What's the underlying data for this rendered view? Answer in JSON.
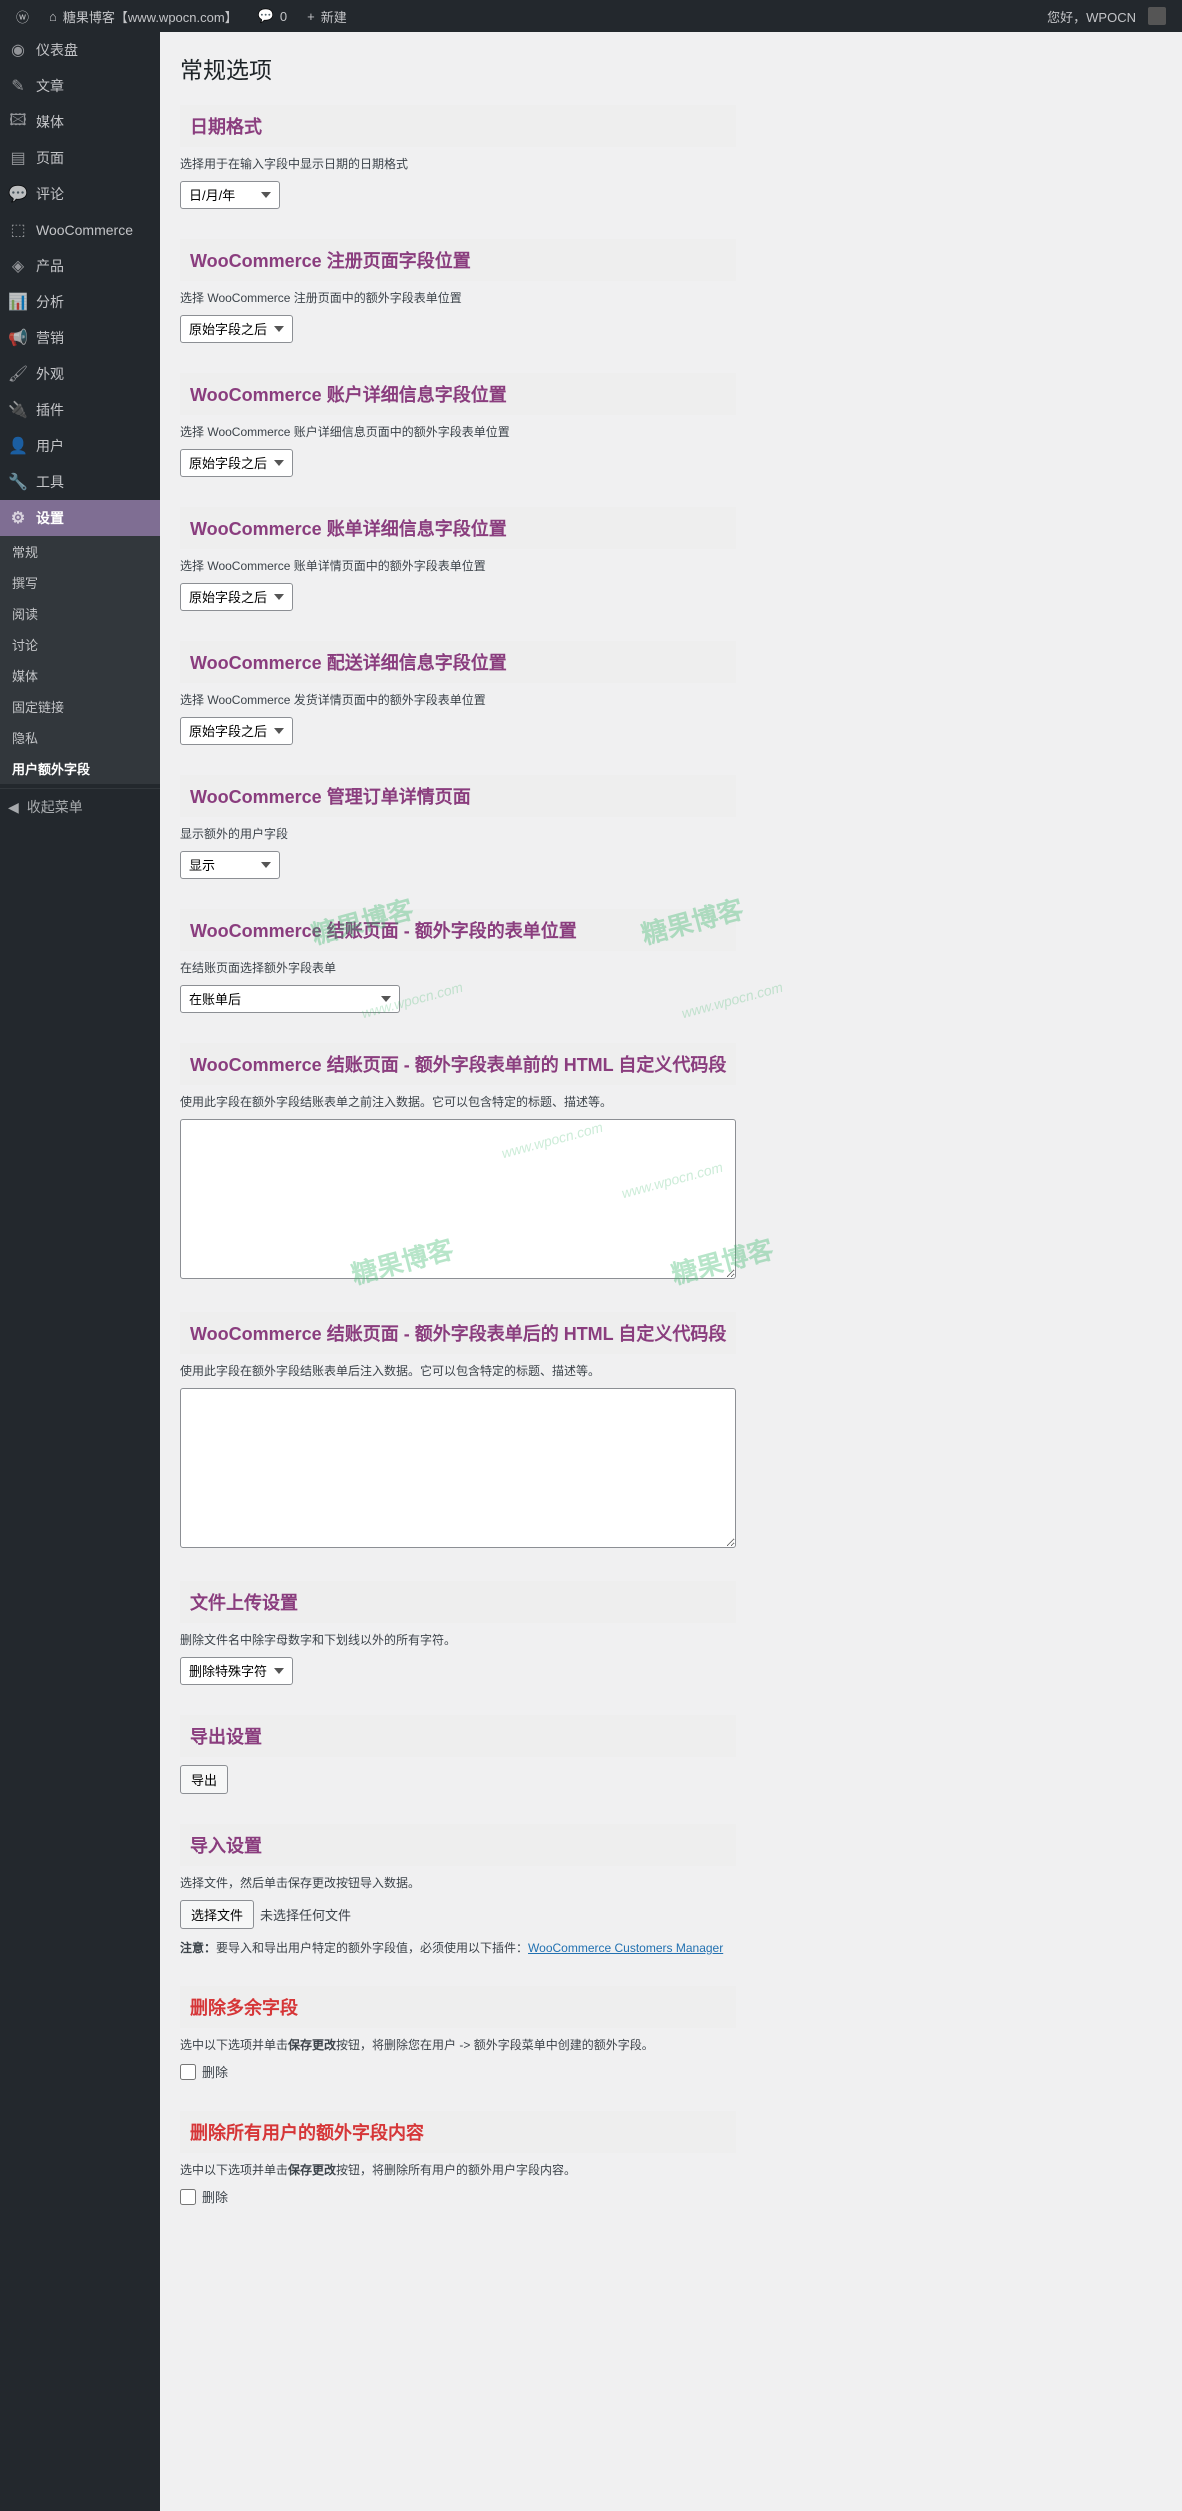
{
  "admin_bar": {
    "site_title": "糖果博客【www.wpocn.com】",
    "comment_count": "0",
    "new_label": "新建",
    "greeting": "您好，WPOCN"
  },
  "sidebar": {
    "items": [
      {
        "icon": "◉",
        "label": "仪表盘"
      },
      {
        "icon": "✎",
        "label": "文章"
      },
      {
        "icon": "🖾",
        "label": "媒体"
      },
      {
        "icon": "▤",
        "label": "页面"
      },
      {
        "icon": "💬",
        "label": "评论"
      },
      {
        "icon": "⬚",
        "label": "WooCommerce"
      },
      {
        "icon": "◈",
        "label": "产品"
      },
      {
        "icon": "📊",
        "label": "分析"
      },
      {
        "icon": "📢",
        "label": "营销"
      },
      {
        "icon": "🖌",
        "label": "外观"
      },
      {
        "icon": "🔌",
        "label": "插件"
      },
      {
        "icon": "👤",
        "label": "用户"
      },
      {
        "icon": "🔧",
        "label": "工具"
      },
      {
        "icon": "⚙",
        "label": "设置",
        "current": true
      }
    ],
    "submenu": [
      {
        "label": "常规"
      },
      {
        "label": "撰写"
      },
      {
        "label": "阅读"
      },
      {
        "label": "讨论"
      },
      {
        "label": "媒体"
      },
      {
        "label": "固定链接"
      },
      {
        "label": "隐私"
      },
      {
        "label": "用户额外字段",
        "current": true
      }
    ],
    "collapse": "收起菜单"
  },
  "page": {
    "title": "常规选项"
  },
  "sections": {
    "date_format": {
      "title": "日期格式",
      "desc": "选择用于在输入字段中显示日期的日期格式",
      "value": "日/月/年"
    },
    "reg_pos": {
      "title": "WooCommerce 注册页面字段位置",
      "desc": "选择 WooCommerce 注册页面中的额外字段表单位置",
      "value": "原始字段之后"
    },
    "account_pos": {
      "title": "WooCommerce 账户详细信息字段位置",
      "desc": "选择 WooCommerce 账户详细信息页面中的额外字段表单位置",
      "value": "原始字段之后"
    },
    "billing_pos": {
      "title": "WooCommerce 账单详细信息字段位置",
      "desc": "选择 WooCommerce 账单详情页面中的额外字段表单位置",
      "value": "原始字段之后"
    },
    "shipping_pos": {
      "title": "WooCommerce 配送详细信息字段位置",
      "desc": "选择 WooCommerce 发货详情页面中的额外字段表单位置",
      "value": "原始字段之后"
    },
    "order_details": {
      "title": "WooCommerce 管理订单详情页面",
      "desc": "显示额外的用户字段",
      "value": "显示"
    },
    "checkout_pos": {
      "title": "WooCommerce 结账页面 - 额外字段的表单位置",
      "desc": "在结账页面选择额外字段表单",
      "value": "在账单后"
    },
    "html_before": {
      "title": "WooCommerce 结账页面 - 额外字段表单前的 HTML 自定义代码段",
      "desc": "使用此字段在额外字段结账表单之前注入数据。它可以包含特定的标题、描述等。"
    },
    "html_after": {
      "title": "WooCommerce 结账页面 - 额外字段表单后的 HTML 自定义代码段",
      "desc": "使用此字段在额外字段结账表单后注入数据。它可以包含特定的标题、描述等。"
    },
    "file_upload": {
      "title": "文件上传设置",
      "desc": "删除文件名中除字母数字和下划线以外的所有字符。",
      "value": "删除特殊字符"
    },
    "export": {
      "title": "导出设置",
      "button": "导出"
    },
    "import": {
      "title": "导入设置",
      "desc": "选择文件，然后单击保存更改按钮导入数据。",
      "button": "选择文件",
      "file_text": "未选择任何文件",
      "note_prefix": "注意：",
      "note_text": "要导入和导出用户特定的额外字段值，必须使用以下插件：",
      "note_link": "WooCommerce Customers Manager"
    },
    "delete_extra": {
      "title": "删除多余字段",
      "desc_pre": "选中以下选项并单击",
      "desc_bold": "保存更改",
      "desc_post": "按钮，将删除您在用户 -> 额外字段菜单中创建的额外字段。",
      "checkbox": "删除"
    },
    "delete_all": {
      "title": "删除所有用户的额外字段内容",
      "desc_pre": "选中以下选项并单击",
      "desc_bold": "保存更改",
      "desc_post": "按钮，将删除所有用户的额外用户字段内容。",
      "checkbox": "删除"
    }
  },
  "watermark": {
    "text": "糖果博客",
    "url": "www.wpocn.com"
  }
}
